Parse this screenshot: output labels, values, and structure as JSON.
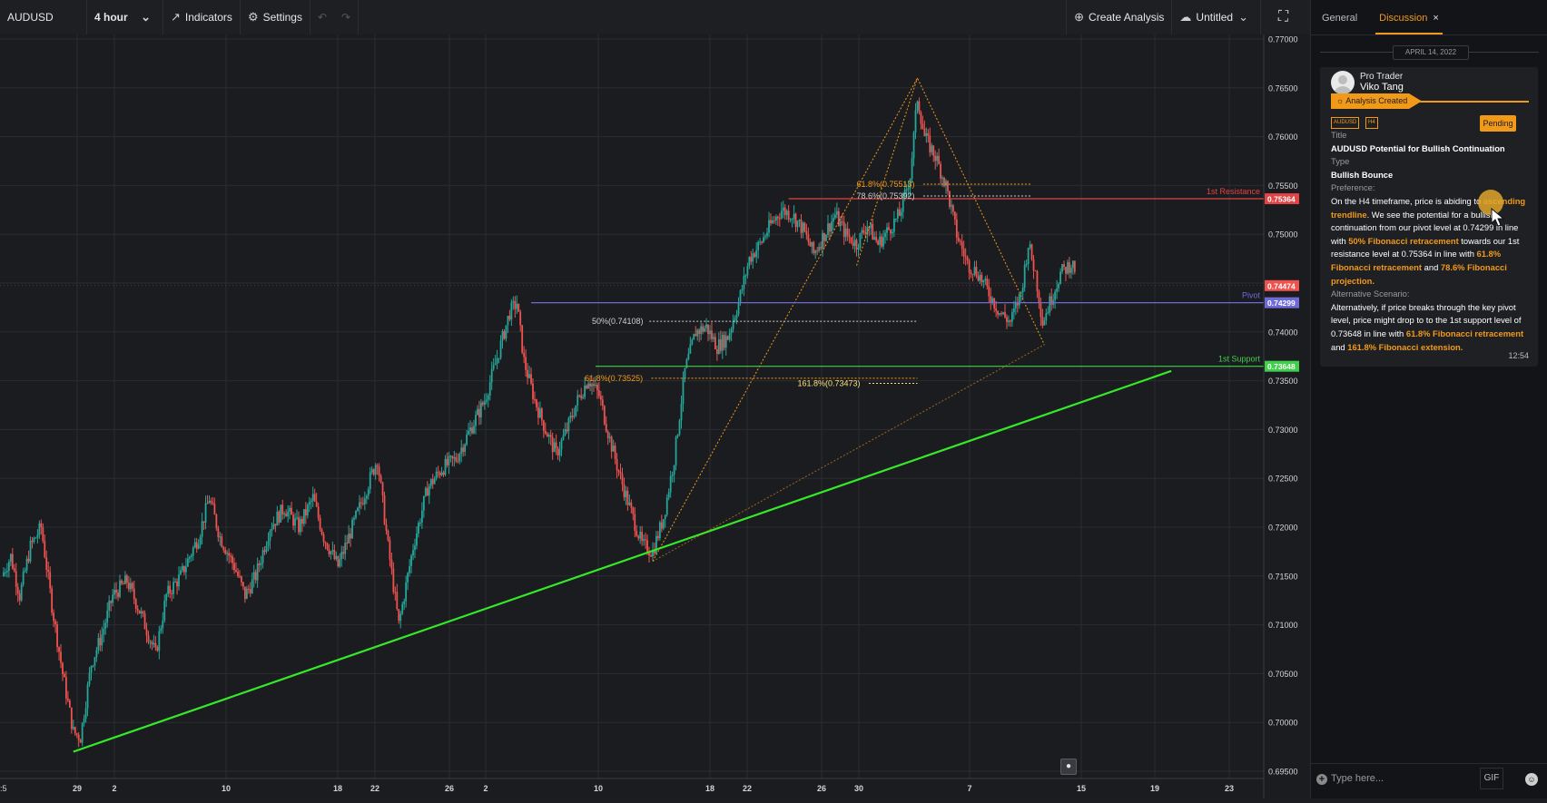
{
  "toolbar": {
    "symbol": "AUDUSD",
    "timeframe": "4 hour",
    "indicators": "Indicators",
    "settings": "Settings",
    "create_analysis": "Create Analysis",
    "layout_name": "Untitled"
  },
  "chart_data": {
    "type": "candlestick",
    "symbol": "AUDUSD",
    "ylim": [
      0.695,
      0.77
    ],
    "y_ticks": [
      "0.77000",
      "0.76500",
      "0.76000",
      "0.75500",
      "0.75000",
      "0.74500",
      "0.74000",
      "0.73500",
      "0.73000",
      "0.72500",
      "0.72000",
      "0.71500",
      "0.71000",
      "0.70500",
      "0.70000",
      "0.69500"
    ],
    "x_ticks": [
      "29",
      "2",
      "10",
      "18",
      "22",
      "26",
      "2",
      "10",
      "18",
      "22",
      "26",
      "30",
      "7",
      "15",
      "19",
      "23"
    ],
    "x_edge_label": ":5",
    "path_points": [
      [
        0,
        0.715
      ],
      [
        5,
        0.717
      ],
      [
        10,
        0.713
      ],
      [
        16,
        0.718
      ],
      [
        22,
        0.72
      ],
      [
        28,
        0.712
      ],
      [
        34,
        0.705
      ],
      [
        40,
        0.699
      ],
      [
        44,
        0.6985
      ],
      [
        50,
        0.706
      ],
      [
        56,
        0.709
      ],
      [
        62,
        0.713
      ],
      [
        70,
        0.7145
      ],
      [
        78,
        0.711
      ],
      [
        86,
        0.707
      ],
      [
        92,
        0.713
      ],
      [
        100,
        0.715
      ],
      [
        110,
        0.719
      ],
      [
        116,
        0.723
      ],
      [
        122,
        0.719
      ],
      [
        130,
        0.716
      ],
      [
        136,
        0.713
      ],
      [
        142,
        0.715
      ],
      [
        150,
        0.72
      ],
      [
        158,
        0.722
      ],
      [
        166,
        0.72
      ],
      [
        174,
        0.723
      ],
      [
        180,
        0.719
      ],
      [
        188,
        0.716
      ],
      [
        196,
        0.72
      ],
      [
        204,
        0.724
      ],
      [
        210,
        0.727
      ],
      [
        216,
        0.718
      ],
      [
        222,
        0.71
      ],
      [
        230,
        0.718
      ],
      [
        238,
        0.724
      ],
      [
        246,
        0.726
      ],
      [
        254,
        0.727
      ],
      [
        262,
        0.73
      ],
      [
        270,
        0.733
      ],
      [
        278,
        0.738
      ],
      [
        284,
        0.742
      ],
      [
        288,
        0.743
      ],
      [
        292,
        0.737
      ],
      [
        298,
        0.733
      ],
      [
        304,
        0.73
      ],
      [
        310,
        0.7275
      ],
      [
        316,
        0.73
      ],
      [
        322,
        0.733
      ],
      [
        328,
        0.7352
      ],
      [
        334,
        0.7335
      ],
      [
        340,
        0.729
      ],
      [
        346,
        0.725
      ],
      [
        352,
        0.7215
      ],
      [
        358,
        0.7182
      ],
      [
        364,
        0.7175
      ],
      [
        370,
        0.721
      ],
      [
        376,
        0.727
      ],
      [
        382,
        0.736
      ],
      [
        388,
        0.74
      ],
      [
        394,
        0.7405
      ],
      [
        400,
        0.7385
      ],
      [
        406,
        0.7395
      ],
      [
        412,
        0.743
      ],
      [
        418,
        0.7475
      ],
      [
        424,
        0.749
      ],
      [
        430,
        0.751
      ],
      [
        436,
        0.7525
      ],
      [
        442,
        0.752
      ],
      [
        448,
        0.7505
      ],
      [
        454,
        0.748
      ],
      [
        460,
        0.75
      ],
      [
        466,
        0.752
      ],
      [
        472,
        0.75
      ],
      [
        478,
        0.749
      ],
      [
        484,
        0.751
      ],
      [
        490,
        0.749
      ],
      [
        496,
        0.7505
      ],
      [
        502,
        0.752
      ],
      [
        508,
        0.756
      ],
      [
        512,
        0.764
      ],
      [
        516,
        0.76
      ],
      [
        522,
        0.758
      ],
      [
        528,
        0.755
      ],
      [
        534,
        0.75
      ],
      [
        540,
        0.747
      ],
      [
        546,
        0.746
      ],
      [
        552,
        0.744
      ],
      [
        558,
        0.742
      ],
      [
        564,
        0.741
      ],
      [
        570,
        0.744
      ],
      [
        574,
        0.749
      ],
      [
        578,
        0.746
      ],
      [
        582,
        0.741
      ],
      [
        586,
        0.743
      ],
      [
        592,
        0.746
      ],
      [
        598,
        0.747
      ],
      [
        600,
        0.7465
      ]
    ],
    "levels": [
      {
        "name": "1st Resistance",
        "value": 0.75364,
        "color": "#e04444",
        "price_label": "0.75364"
      },
      {
        "name": "Pivot",
        "value": 0.74299,
        "color": "#6f6ad8",
        "price_label": "0.74299"
      },
      {
        "name": "1st Support",
        "value": 0.73648,
        "color": "#3fcf4a",
        "price_label": "0.73648"
      }
    ],
    "current_price_label": "0.74474",
    "trendline": {
      "from": [
        40,
        0.697
      ],
      "to": [
        654,
        0.736
      ],
      "color": "#35e82a"
    },
    "fib_labels": [
      {
        "text": "61.8%(0.75513)",
        "value": 0.75513,
        "color": "#f19a1a"
      },
      {
        "text": "78.6%(0.75392)",
        "value": 0.75392,
        "color": "#cfcfcf"
      },
      {
        "text": "50%(0.74108)",
        "value": 0.74108,
        "color": "#cfcfcf"
      },
      {
        "text": "61.8%(0.73525)",
        "value": 0.73525,
        "color": "#f19a1a"
      },
      {
        "text": "161.8%(0.73473)",
        "value": 0.73473,
        "color": "#f7e27a"
      }
    ]
  },
  "panel": {
    "tab_general": "General",
    "tab_discussion": "Discussion",
    "tab_close": "×",
    "date": "APRIL 14, 2022",
    "role": "Pro Trader",
    "author": "Viko Tang",
    "badge": "Analysis Created",
    "tag_symbol": "AUDUSD",
    "tag_tf": "H4",
    "status": "Pending",
    "title_label": "Title",
    "title_value": "AUDUSD Potential for Bullish Continuation",
    "type_label": "Type",
    "type_value": "Bullish Bounce",
    "pref_label": "Preference:",
    "pref_1": "On the H4 timeframe, price is abiding to ",
    "pref_hl1": "ascending trendline",
    "pref_2": ". We see the potential for a bullish continuation from our pivot level at 0.74299 in line with ",
    "pref_hl2": "50% Fibonacci retracement",
    "pref_3": " towards our 1st resistance level at 0.75364 in line with ",
    "pref_hl3": "61.8% Fibonacci retracement",
    "pref_4": " and ",
    "pref_hl4": "78.6% Fibonacci projection.",
    "alt_label": "Alternative Scenario:",
    "alt_1": "Alternatively, if price breaks through the key pivot level, price might drop to to the 1st support level of 0.73648 in line with ",
    "alt_hl1": "61.8% Fibonacci retracement",
    "alt_2": " and ",
    "alt_hl2": "161.8% Fibonacci extension.",
    "time": "12:54",
    "input_placeholder": "Type here...",
    "gif": "GIF"
  }
}
